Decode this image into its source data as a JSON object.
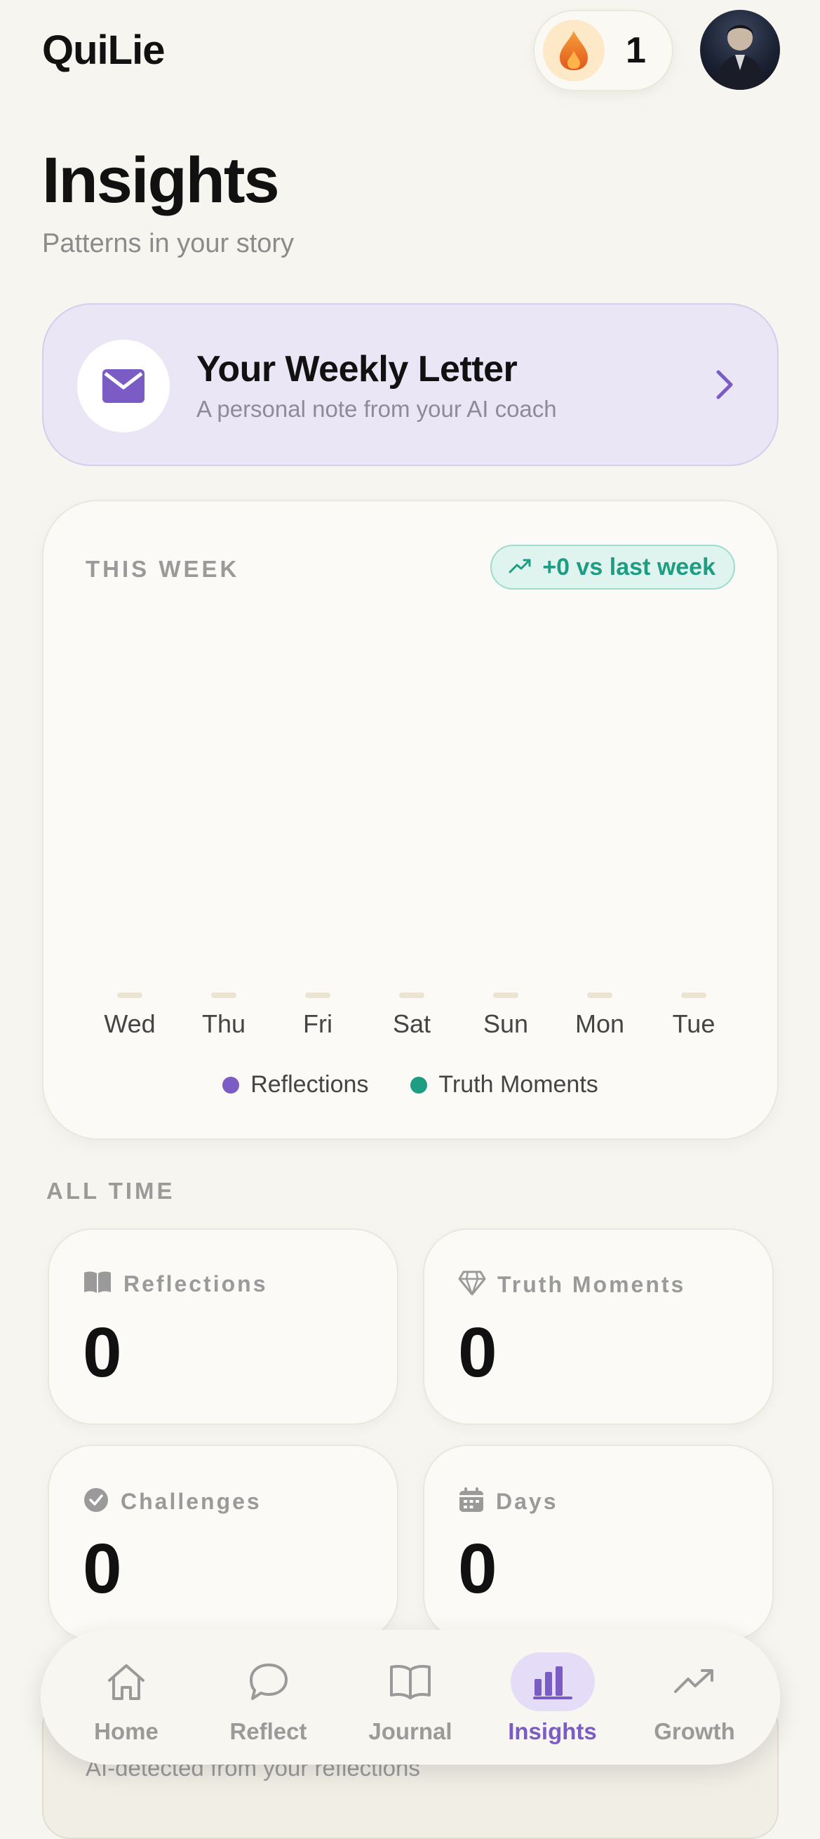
{
  "app": {
    "title": "QuiLie",
    "streak_count": "1"
  },
  "page": {
    "title": "Insights",
    "subtitle": "Patterns in your story"
  },
  "weekly_letter": {
    "title": "Your Weekly Letter",
    "subtitle": "A personal note from your AI coach"
  },
  "this_week": {
    "label": "THIS WEEK",
    "trend": "+0 vs last week"
  },
  "chart_data": {
    "type": "bar",
    "categories": [
      "Wed",
      "Thu",
      "Fri",
      "Sat",
      "Sun",
      "Mon",
      "Tue"
    ],
    "series": [
      {
        "name": "Reflections",
        "values": [
          0,
          0,
          0,
          0,
          0,
          0,
          0
        ],
        "color": "#7a5cc4"
      },
      {
        "name": "Truth Moments",
        "values": [
          0,
          0,
          0,
          0,
          0,
          0,
          0
        ],
        "color": "#1f9d83"
      }
    ],
    "legend": "bottom",
    "grid": false
  },
  "all_time": {
    "label": "ALL TIME",
    "stats": [
      {
        "label": "Reflections",
        "value": "0",
        "icon": "book-icon"
      },
      {
        "label": "Truth Moments",
        "value": "0",
        "icon": "diamond-icon"
      },
      {
        "label": "Challenges",
        "value": "0",
        "icon": "check-circle-icon"
      },
      {
        "label": "Days",
        "value": "0",
        "icon": "calendar-icon"
      }
    ]
  },
  "behind_card": {
    "text": "AI-detected from your reflections"
  },
  "nav": {
    "items": [
      {
        "label": "Home",
        "icon": "home-icon"
      },
      {
        "label": "Reflect",
        "icon": "chat-bubble-icon"
      },
      {
        "label": "Journal",
        "icon": "open-book-icon"
      },
      {
        "label": "Insights",
        "icon": "bar-chart-icon",
        "active": true
      },
      {
        "label": "Growth",
        "icon": "trending-up-icon"
      }
    ]
  },
  "colors": {
    "accent": "#7a5cc4",
    "teal": "#1f9d83",
    "background": "#f7f5ef",
    "flame": "#f07a22"
  }
}
